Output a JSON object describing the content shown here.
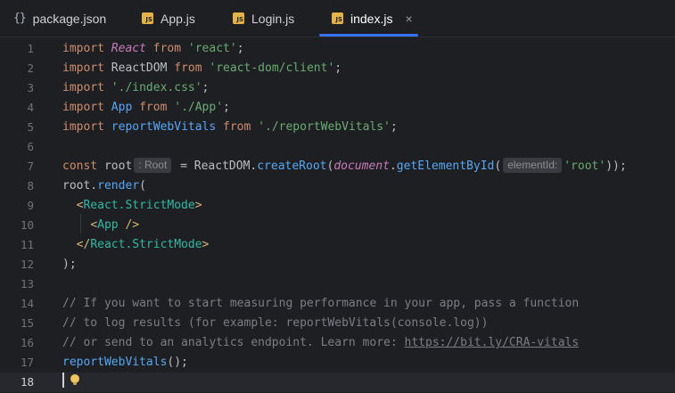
{
  "tabs": [
    {
      "label": "package.json",
      "icon": "json-file-icon",
      "active": false
    },
    {
      "label": "App.js",
      "icon": "js-file-icon",
      "active": false
    },
    {
      "label": "Login.js",
      "icon": "js-file-icon",
      "active": false
    },
    {
      "label": "index.js",
      "icon": "js-file-icon",
      "active": true
    }
  ],
  "icons": {
    "json_glyph": "{}",
    "js_glyph": "JS",
    "close_glyph": "×"
  },
  "editor": {
    "current_line": 18,
    "line_numbers": [
      "1",
      "2",
      "3",
      "4",
      "5",
      "6",
      "7",
      "8",
      "9",
      "10",
      "11",
      "12",
      "13",
      "14",
      "15",
      "16",
      "17",
      "18"
    ],
    "lines": [
      [
        {
          "c": "kw",
          "t": "import "
        },
        {
          "c": "cls",
          "t": "React"
        },
        {
          "c": "kw",
          "t": " from "
        },
        {
          "c": "str",
          "t": "'react'"
        },
        {
          "c": "plain",
          "t": ";"
        }
      ],
      [
        {
          "c": "kw",
          "t": "import "
        },
        {
          "c": "plain",
          "t": "ReactDOM"
        },
        {
          "c": "kw",
          "t": " from "
        },
        {
          "c": "str",
          "t": "'react-dom/client'"
        },
        {
          "c": "plain",
          "t": ";"
        }
      ],
      [
        {
          "c": "kw",
          "t": "import "
        },
        {
          "c": "str",
          "t": "'./index.css'"
        },
        {
          "c": "plain",
          "t": ";"
        }
      ],
      [
        {
          "c": "kw",
          "t": "import "
        },
        {
          "c": "fn",
          "t": "App"
        },
        {
          "c": "kw",
          "t": " from "
        },
        {
          "c": "str",
          "t": "'./App'"
        },
        {
          "c": "plain",
          "t": ";"
        }
      ],
      [
        {
          "c": "kw",
          "t": "import "
        },
        {
          "c": "fn",
          "t": "reportWebVitals"
        },
        {
          "c": "kw",
          "t": " from "
        },
        {
          "c": "str",
          "t": "'./reportWebVitals'"
        },
        {
          "c": "plain",
          "t": ";"
        }
      ],
      [],
      [
        {
          "c": "kw",
          "t": "const "
        },
        {
          "c": "plain",
          "t": "root"
        },
        {
          "c": "hint",
          "t": ": Root"
        },
        {
          "c": "plain",
          "t": " = ReactDOM."
        },
        {
          "c": "fn",
          "t": "createRoot"
        },
        {
          "c": "plain",
          "t": "("
        },
        {
          "c": "obj",
          "t": "document"
        },
        {
          "c": "plain",
          "t": "."
        },
        {
          "c": "fn",
          "t": "getElementById"
        },
        {
          "c": "plain",
          "t": "("
        },
        {
          "c": "hint",
          "t": "elementId:"
        },
        {
          "c": "str",
          "t": "'root'"
        },
        {
          "c": "plain",
          "t": "));"
        }
      ],
      [
        {
          "c": "plain",
          "t": "root."
        },
        {
          "c": "fn",
          "t": "render"
        },
        {
          "c": "plain",
          "t": "("
        }
      ],
      [
        {
          "c": "plain",
          "t": "  "
        },
        {
          "c": "tag",
          "t": "<"
        },
        {
          "c": "comp",
          "t": "React.StrictMode"
        },
        {
          "c": "tag",
          "t": ">"
        }
      ],
      [
        {
          "c": "plain",
          "t": "    "
        },
        {
          "c": "tag",
          "t": "<"
        },
        {
          "c": "comp",
          "t": "App"
        },
        {
          "c": "tag",
          "t": " />"
        }
      ],
      [
        {
          "c": "plain",
          "t": "  "
        },
        {
          "c": "tag",
          "t": "</"
        },
        {
          "c": "comp",
          "t": "React.StrictMode"
        },
        {
          "c": "tag",
          "t": ">"
        }
      ],
      [
        {
          "c": "plain",
          "t": ");"
        }
      ],
      [],
      [
        {
          "c": "cm",
          "t": "// If you want to start measuring performance in your app, pass a function"
        }
      ],
      [
        {
          "c": "cm",
          "t": "// to log results (for example: reportWebVitals(console.log))"
        }
      ],
      [
        {
          "c": "cm",
          "t": "// or send to an analytics endpoint. Learn more: "
        },
        {
          "c": "link",
          "t": "https://bit.ly/CRA-vitals"
        }
      ],
      [
        {
          "c": "fn",
          "t": "reportWebVitals"
        },
        {
          "c": "plain",
          "t": "();"
        }
      ],
      []
    ]
  },
  "colors": {
    "background": "#1e1f22",
    "active_tab_underline": "#3574f0",
    "keyword": "#cf8e6d",
    "string": "#6aab73",
    "function": "#56a8f5",
    "comment": "#7a7e85"
  }
}
